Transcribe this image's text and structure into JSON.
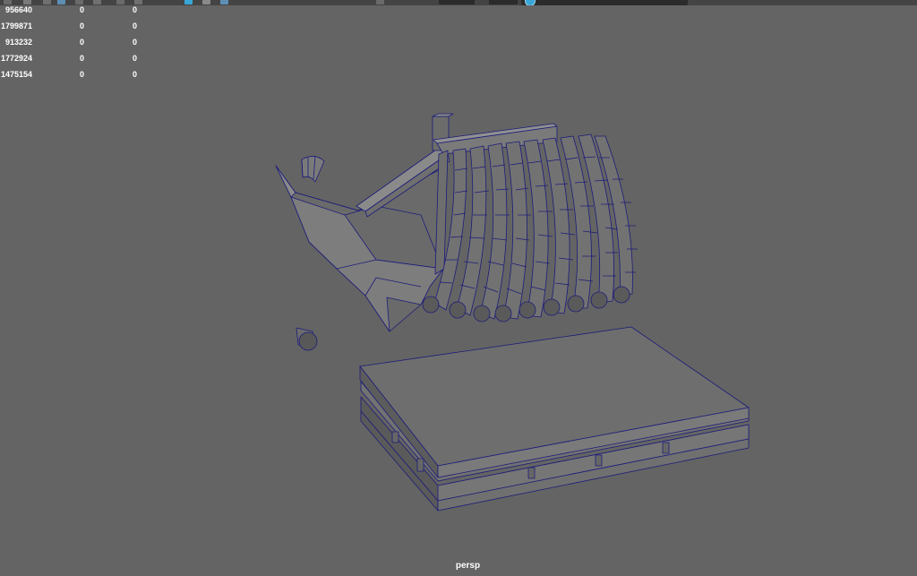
{
  "toolbar": {
    "icons": [
      "undo-icon",
      "grid-icon",
      "camera-icon",
      "xray-icon",
      "shading-icon",
      "wireframe-icon",
      "texture-icon",
      "lights-icon",
      "shadow-icon",
      "isolate-icon",
      "gate-icon",
      "exposure-icon",
      "gamma-icon",
      "colorspace-icon"
    ],
    "accent": "#3aa6d8"
  },
  "hud": {
    "rows": [
      [
        "956640",
        "0",
        "0"
      ],
      [
        "1799871",
        "0",
        "0"
      ],
      [
        "913232",
        "0",
        "0"
      ],
      [
        "1772924",
        "0",
        "0"
      ],
      [
        "1475154",
        "0",
        "0"
      ]
    ]
  },
  "viewport": {
    "background": "#646464",
    "wire_color": "#1c1c7a",
    "face_color": "#6f6f6f",
    "camera": "persp"
  }
}
